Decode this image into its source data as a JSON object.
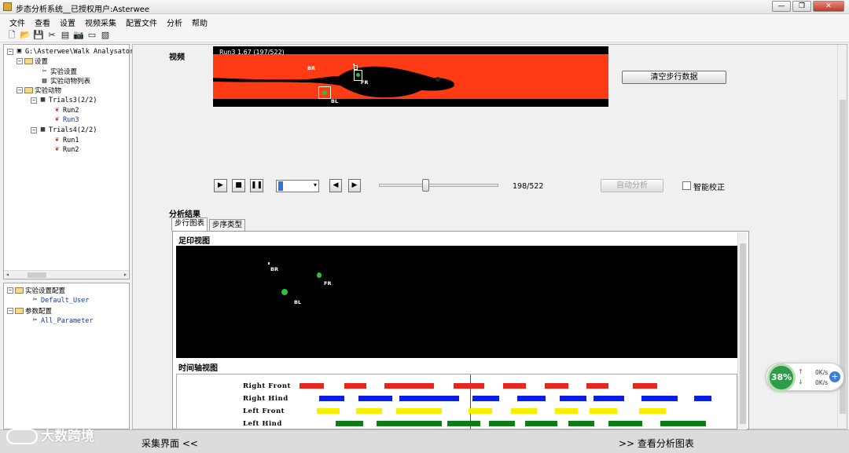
{
  "window": {
    "title": "步态分析系统__已授权用户:Asterwee",
    "minimize": "—",
    "maximize": "❐",
    "close": "✕"
  },
  "menu": [
    "文件",
    "查看",
    "设置",
    "视频采集",
    "配置文件",
    "分析",
    "帮助"
  ],
  "toolbar_icons": [
    "new-file-icon",
    "open-folder-icon",
    "save-icon",
    "tools-icon",
    "list-icon",
    "camera-icon",
    "rectangle-icon",
    "report-icon"
  ],
  "tree_top": {
    "root": "G:\\Asterwee\\Walk Analysator",
    "settings": "设置",
    "experiment_settings": "实验设置",
    "animal_list": "实验动物列表",
    "animals": "实验动物",
    "trials": [
      {
        "label": "Trials3(2/2)",
        "runs": [
          "Run2",
          "Run3"
        ]
      },
      {
        "label": "Trials4(2/2)",
        "runs": [
          "Run1",
          "Run2"
        ]
      }
    ]
  },
  "tree_bottom": {
    "experiment_config": "实验设置配置",
    "default_user": "Default_User",
    "parameter_config": "参数配置",
    "all_parameter": "All_Parameter"
  },
  "video": {
    "section_label": "视频",
    "caption": "Run3  1.67  (197/522)",
    "tags": {
      "br": "BR",
      "fr": "FR",
      "bl": "BL"
    }
  },
  "buttons": {
    "clear_step_data": "清空步行数据",
    "auto_analyze": "自动分析"
  },
  "playback": {
    "frame_count": "198/522",
    "slider_fraction": 0.38,
    "smart_correction_label": "智能校正",
    "smart_correction_checked": false
  },
  "analysis": {
    "section_label": "分析结果",
    "tabs": [
      "步行图表",
      "步序类型"
    ],
    "active_tab": 0,
    "footprint_label": "足印视图",
    "footprint_tags": {
      "br": "BR",
      "fr": "FR",
      "bl": "BL"
    },
    "timeline_label": "时间轴视图"
  },
  "timeline_rows": [
    {
      "name": "Right Front",
      "color": "#e8261b",
      "segments": [
        [
          0.0,
          0.055
        ],
        [
          0.103,
          0.152
        ],
        [
          0.195,
          0.308
        ],
        [
          0.353,
          0.422
        ],
        [
          0.465,
          0.518
        ],
        [
          0.562,
          0.616
        ],
        [
          0.656,
          0.707
        ],
        [
          0.762,
          0.818
        ]
      ]
    },
    {
      "name": "Right Hind",
      "color": "#0a1ee8",
      "segments": [
        [
          0.045,
          0.102
        ],
        [
          0.135,
          0.213
        ],
        [
          0.228,
          0.365
        ],
        [
          0.396,
          0.456
        ],
        [
          0.498,
          0.563
        ],
        [
          0.595,
          0.656
        ],
        [
          0.673,
          0.743
        ],
        [
          0.782,
          0.866
        ],
        [
          0.902,
          0.942
        ]
      ]
    },
    {
      "name": "Left Front",
      "color": "#f6f000",
      "segments": [
        [
          0.04,
          0.092
        ],
        [
          0.13,
          0.188
        ],
        [
          0.222,
          0.325
        ],
        [
          0.387,
          0.44
        ],
        [
          0.484,
          0.543
        ],
        [
          0.584,
          0.636
        ],
        [
          0.664,
          0.726
        ],
        [
          0.777,
          0.838
        ]
      ]
    },
    {
      "name": "Left Hind",
      "color": "#0f7d16",
      "segments": [
        [
          0.083,
          0.145
        ],
        [
          0.177,
          0.326
        ],
        [
          0.338,
          0.413
        ],
        [
          0.434,
          0.492
        ],
        [
          0.517,
          0.59
        ],
        [
          0.616,
          0.675
        ],
        [
          0.707,
          0.784
        ],
        [
          0.826,
          0.93
        ]
      ]
    }
  ],
  "bottom": {
    "capture_link": "采集界面  <<",
    "chart_link": ">>  查看分析图表",
    "watermark": "大数跨境"
  },
  "net_widget": {
    "percent": "38%",
    "up_rate": "0K/s",
    "down_rate": "0K/s"
  },
  "colors": {
    "arena": "#ff3b16",
    "paw_green": "#2fbf3a"
  }
}
